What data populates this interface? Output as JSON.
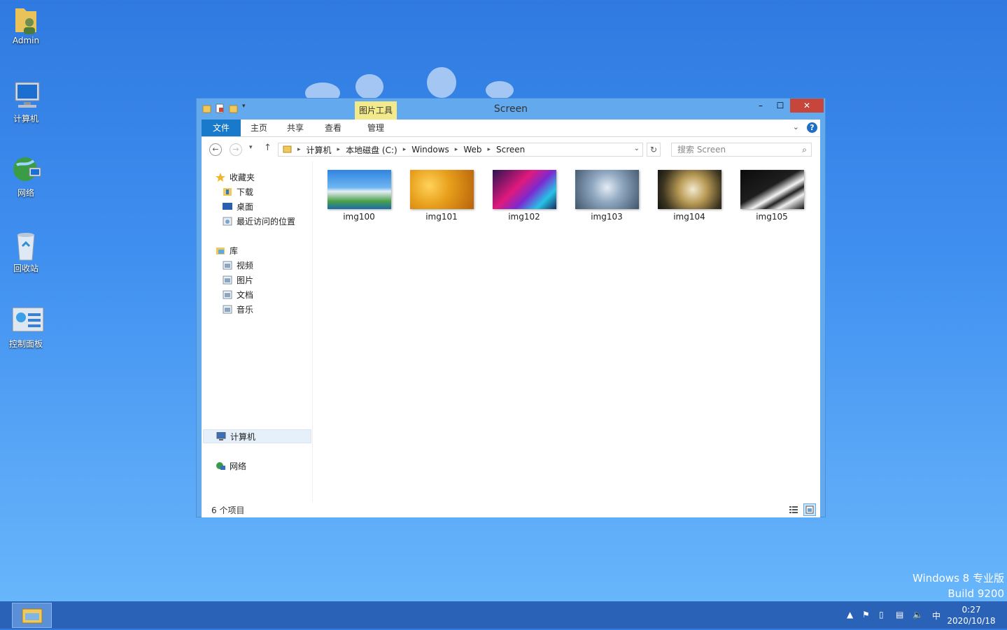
{
  "desktop": {
    "icons": [
      {
        "label": "Admin"
      },
      {
        "label": "计算机"
      },
      {
        "label": "网络"
      },
      {
        "label": "回收站"
      },
      {
        "label": "控制面板"
      }
    ],
    "watermark": {
      "line1": "Windows 8 专业版",
      "line2": "Build 9200"
    }
  },
  "window": {
    "title": "Screen",
    "contextual_tab_group": "图片工具",
    "controls": {
      "minimize": "–",
      "maximize": "☐",
      "close": "✕"
    },
    "ribbon_tabs": [
      {
        "label": "文件"
      },
      {
        "label": "主页"
      },
      {
        "label": "共享"
      },
      {
        "label": "查看"
      },
      {
        "label": "管理"
      }
    ],
    "address": {
      "segments": [
        "计算机",
        "本地磁盘 (C:)",
        "Windows",
        "Web",
        "Screen"
      ]
    },
    "search": {
      "placeholder": "搜索 Screen"
    },
    "nav_pane": {
      "favorites": {
        "label": "收藏夹",
        "items": [
          "下载",
          "桌面",
          "最近访问的位置"
        ]
      },
      "libraries": {
        "label": "库",
        "items": [
          "视频",
          "图片",
          "文档",
          "音乐"
        ]
      },
      "computer": {
        "label": "计算机"
      },
      "network": {
        "label": "网络"
      }
    },
    "files": [
      {
        "name": "img100"
      },
      {
        "name": "img101"
      },
      {
        "name": "img102"
      },
      {
        "name": "img103"
      },
      {
        "name": "img104"
      },
      {
        "name": "img105"
      }
    ],
    "status": {
      "count": "6 个项目"
    }
  },
  "taskbar": {
    "ime": "中",
    "clock": {
      "time": "0:27",
      "date": "2020/10/18"
    }
  }
}
